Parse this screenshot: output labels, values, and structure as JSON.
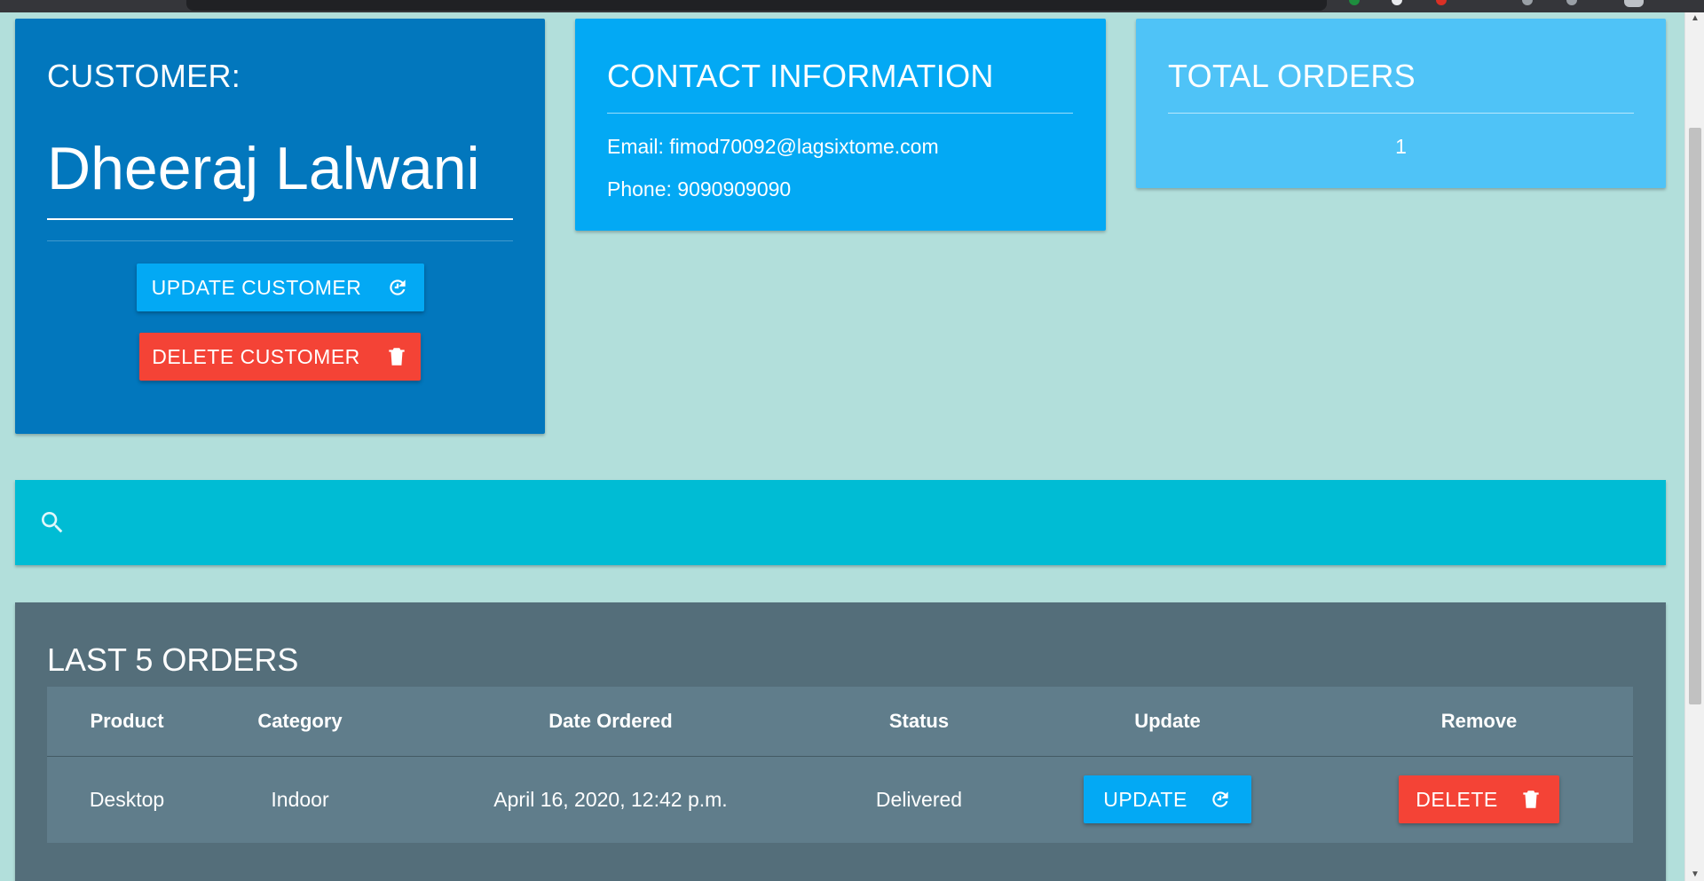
{
  "customer_card": {
    "title": "CUSTOMER:",
    "name": "Dheeraj Lalwani",
    "update_label": "UPDATE CUSTOMER",
    "delete_label": "DELETE CUSTOMER"
  },
  "contact_card": {
    "title": "CONTACT INFORMATION",
    "email": "Email: fimod70092@lagsixtome.com",
    "phone": "Phone: 9090909090"
  },
  "total_card": {
    "title": "TOTAL ORDERS",
    "value": "1"
  },
  "search": {
    "placeholder": "",
    "icon": "search-icon"
  },
  "orders": {
    "title": "LAST 5 ORDERS",
    "columns": [
      "Product",
      "Category",
      "Date Ordered",
      "Status",
      "Update",
      "Remove"
    ],
    "rows": [
      {
        "product": "Desktop",
        "category": "Indoor",
        "date": "April 16, 2020, 12:42 p.m.",
        "status": "Delivered",
        "update_label": "UPDATE",
        "delete_label": "DELETE"
      }
    ]
  },
  "colors": {
    "page_bg": "#b2dfdb",
    "customer_card": "#0277bd",
    "contact_card": "#03a9f4",
    "total_card": "#4fc3f7",
    "search_bar": "#00bcd4",
    "orders_card": "#546e7a",
    "table_bg": "#607d8b",
    "button_blue": "#03a9f4",
    "button_red": "#f44336"
  }
}
